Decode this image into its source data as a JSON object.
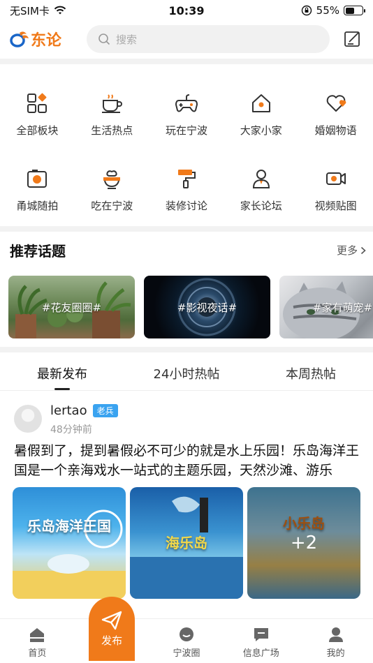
{
  "status_bar": {
    "carrier": "无SIM卡",
    "time": "10:39",
    "battery": "55%",
    "battery_level": 0.55
  },
  "header": {
    "logo_text": "东论",
    "search_placeholder": "搜索"
  },
  "categories": [
    {
      "label": "全部板块",
      "icon": "grid-icon"
    },
    {
      "label": "生活热点",
      "icon": "coffee-icon"
    },
    {
      "label": "玩在宁波",
      "icon": "gamepad-icon"
    },
    {
      "label": "大家小家",
      "icon": "home-icon"
    },
    {
      "label": "婚姻物语",
      "icon": "heart-icon"
    },
    {
      "label": "甬城随拍",
      "icon": "camera-icon"
    },
    {
      "label": "吃在宁波",
      "icon": "cooking-pot-icon"
    },
    {
      "label": "装修讨论",
      "icon": "paint-roller-icon"
    },
    {
      "label": "家长论坛",
      "icon": "parent-icon"
    },
    {
      "label": "视频贴图",
      "icon": "video-icon"
    }
  ],
  "topics_section": {
    "title": "推荐话题",
    "more": "更多",
    "topics": [
      {
        "label": "#花友圈圈#"
      },
      {
        "label": "#影视夜话#"
      },
      {
        "label": "#家有萌宠#"
      }
    ]
  },
  "tabs": [
    {
      "label": "最新发布"
    },
    {
      "label": "24小时热帖"
    },
    {
      "label": "本周热帖"
    }
  ],
  "post": {
    "username": "lertao",
    "badge": "老兵",
    "time": "48分钟前",
    "text": "暑假到了，提到暑假必不可少的就是水上乐园！乐岛海洋王国是一个亲海戏水一站式的主题乐园，天然沙滩、游乐",
    "images": [
      {
        "caption": "乐岛海洋王国"
      },
      {
        "caption": "海乐岛"
      },
      {
        "caption": "小乐岛",
        "more_count": "+2"
      }
    ]
  },
  "bottom_nav": [
    {
      "label": "首页",
      "icon": "home-icon"
    },
    {
      "label": "发布",
      "icon": "send-icon"
    },
    {
      "label": "宁波圈",
      "icon": "chat-bubble-icon"
    },
    {
      "label": "信息广场",
      "icon": "message-square-icon"
    },
    {
      "label": "我的",
      "icon": "user-icon"
    }
  ],
  "colors": {
    "accent": "#f07a1a",
    "badge": "#3aa3f0"
  }
}
